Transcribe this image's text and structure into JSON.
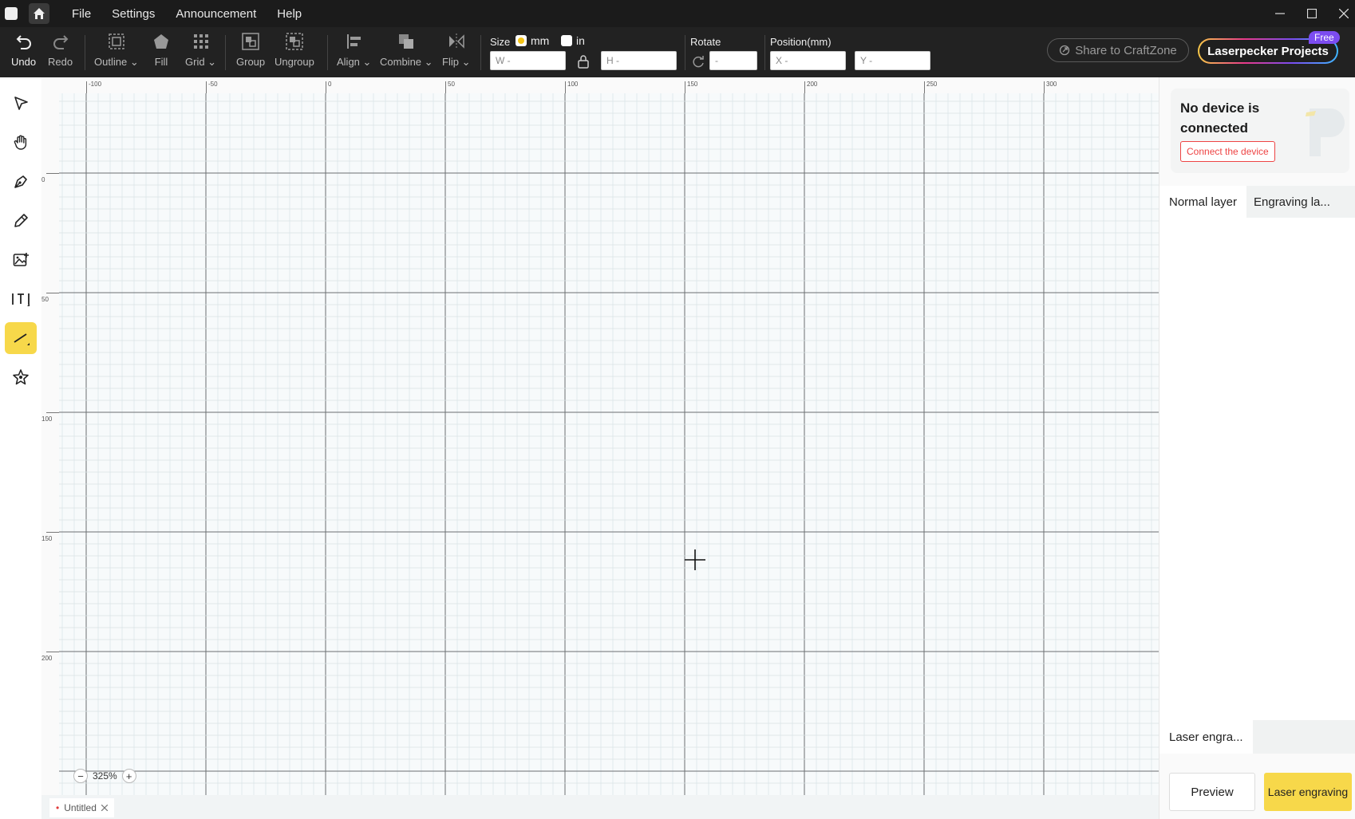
{
  "titlebar": {
    "menus": [
      "File",
      "Settings",
      "Announcement",
      "Help"
    ]
  },
  "toolbar": {
    "undo": "Undo",
    "redo": "Redo",
    "outline": "Outline",
    "fill": "Fill",
    "grid": "Grid",
    "group": "Group",
    "ungroup": "Ungroup",
    "align": "Align",
    "combine": "Combine",
    "flip": "Flip",
    "size_label": "Size",
    "unit_mm": "mm",
    "unit_in": "in",
    "unit_selected": "mm",
    "width_placeholder": "W -",
    "height_placeholder": "H -",
    "rotate_label": "Rotate",
    "rotate_placeholder": "-",
    "position_label": "Position(mm)",
    "x_placeholder": "X -",
    "y_placeholder": "Y -",
    "share": "Share to CraftZone",
    "projects": "Laserpecker Projects",
    "free_badge": "Free"
  },
  "left_tools": [
    "select-tool",
    "hand-tool",
    "pen-tool",
    "pencil-tool",
    "image-tool",
    "text-tool",
    "line-tool",
    "shape-tool"
  ],
  "left_tools_active": "line-tool",
  "rulers": {
    "horizontal": [
      "-100",
      "-50",
      "0",
      "50",
      "100",
      "150",
      "200",
      "250",
      "300"
    ],
    "vertical": [
      "0",
      "50",
      "100",
      "150",
      "200"
    ]
  },
  "zoom": {
    "value": "325%"
  },
  "document": {
    "tab_name": "Untitled",
    "unsaved_marker": "•"
  },
  "right_panel": {
    "device_title": "No device is connected",
    "connect_button": "Connect the device",
    "layer_tabs": [
      "Normal layer",
      "Engraving la..."
    ],
    "engrave_tab": "Laser engra...",
    "preview_button": "Preview",
    "engrave_button": "Laser engraving"
  },
  "colors": {
    "accent": "#f7d84a",
    "toolbar_bg": "#222222",
    "titlebar_bg": "#1b1b1b",
    "danger": "#e44444"
  }
}
